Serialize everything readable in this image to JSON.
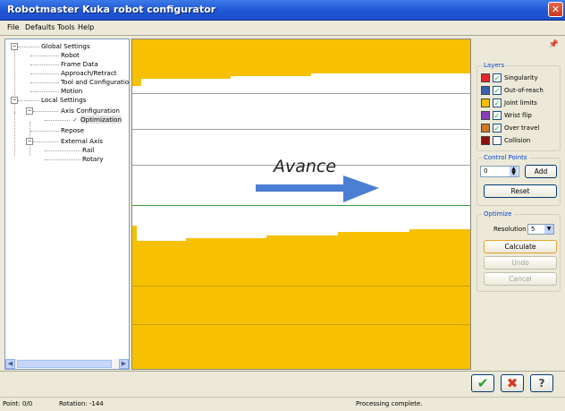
{
  "window": {
    "title": "Robotmaster Kuka robot configurator",
    "close_glyph": "✕"
  },
  "menu": {
    "file": "File",
    "defaults": "Defaults",
    "tools": "Tools",
    "help": "Help"
  },
  "tree": {
    "items": [
      {
        "label": "Global Settings",
        "toggle": "−"
      },
      {
        "label": "Robot"
      },
      {
        "label": "Frame Data"
      },
      {
        "label": "Approach/Retract"
      },
      {
        "label": "Tool and Configuratio"
      },
      {
        "label": "Motion"
      },
      {
        "label": "Local Settings",
        "toggle": "−"
      },
      {
        "label": "Axis Configuration",
        "toggle": "−"
      },
      {
        "label": "Optimization",
        "check": "✓"
      },
      {
        "label": "Repose"
      },
      {
        "label": "External Axis",
        "toggle": "−"
      },
      {
        "label": "Rail"
      },
      {
        "label": "Rotary"
      }
    ],
    "scroll_left": "◀",
    "scroll_right": "▶"
  },
  "plot": {
    "annotation": "Avance"
  },
  "layers": {
    "title": "Layers",
    "items": [
      {
        "label": "Singularity",
        "color": "#e8262a",
        "checked": "✓"
      },
      {
        "label": "Out-of-reach",
        "color": "#3c5fb0",
        "checked": "✓"
      },
      {
        "label": "Joint limits",
        "color": "#f7c000",
        "checked": "✓"
      },
      {
        "label": "Wrist flip",
        "color": "#8a3db8",
        "checked": "✓"
      },
      {
        "label": "Over travel",
        "color": "#c87a2c",
        "checked": "✓"
      },
      {
        "label": "Collision",
        "color": "#8b1010",
        "checked": ""
      }
    ]
  },
  "control_points": {
    "title": "Control Points",
    "value": "0",
    "add": "Add",
    "reset": "Reset"
  },
  "optimize": {
    "title": "Optimize",
    "resolution_label": "Resolution",
    "resolution_value": "5",
    "calculate": "Calculate",
    "undo": "Undo",
    "cancel": "Cancel"
  },
  "footer": {
    "ok": "✔",
    "cancel": "✖",
    "help": "?"
  },
  "status": {
    "point": "Point: 0/0",
    "rotation": "Rotation: -144",
    "message": "Processing complete."
  },
  "colors": {
    "accent": "#0046d5",
    "warning_band": "#f7c000",
    "path_line": "#3a9a3a",
    "arrow": "#4a7fd4"
  }
}
